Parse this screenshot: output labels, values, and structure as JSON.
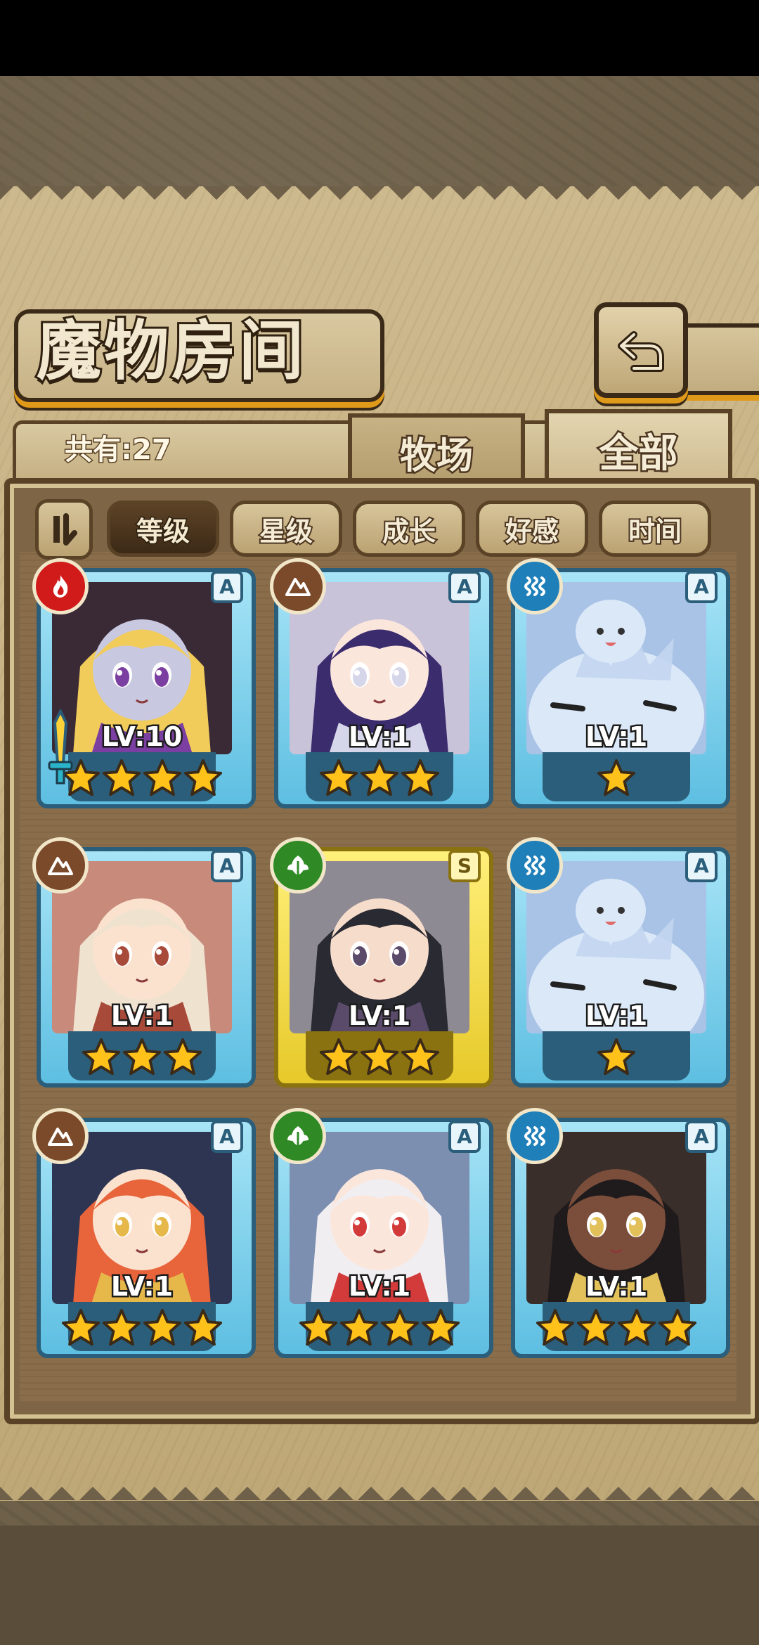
{
  "header": {
    "title": "魔物房间"
  },
  "count": {
    "label": "共有:27"
  },
  "tabs": [
    {
      "label": "牧场",
      "active": false
    },
    {
      "label": "全部",
      "active": true
    }
  ],
  "sort": {
    "buttons": [
      {
        "label": "等级",
        "active": true
      },
      {
        "label": "星级",
        "active": false
      },
      {
        "label": "成长",
        "active": false
      },
      {
        "label": "好感",
        "active": false
      },
      {
        "label": "时间",
        "active": false
      }
    ]
  },
  "colors": {
    "fire": "#d11a1a",
    "earth": "#7a4a2a",
    "water": "#1f7fb8",
    "wood": "#2f8a25",
    "card_frame_a": "#5ebfe2",
    "card_frame_s": "#e7c92a",
    "star": "#ffc21a"
  },
  "monsters": [
    {
      "element": "fire",
      "rank": "A",
      "level": "LV:10",
      "stars": 4,
      "equipped": true,
      "portrait": "blonde-demon-girl"
    },
    {
      "element": "earth",
      "rank": "A",
      "level": "LV:1",
      "stars": 3,
      "equipped": false,
      "portrait": "purple-hair-girl"
    },
    {
      "element": "water",
      "rank": "A",
      "level": "LV:1",
      "stars": 1,
      "equipped": false,
      "portrait": "blue-slime"
    },
    {
      "element": "earth",
      "rank": "A",
      "level": "LV:1",
      "stars": 3,
      "equipped": false,
      "portrait": "cream-hair-girl"
    },
    {
      "element": "wood",
      "rank": "S",
      "level": "LV:1",
      "stars": 3,
      "equipped": false,
      "portrait": "black-hair-glasses-girl"
    },
    {
      "element": "water",
      "rank": "A",
      "level": "LV:1",
      "stars": 1,
      "equipped": false,
      "portrait": "blue-slime"
    },
    {
      "element": "earth",
      "rank": "A",
      "level": "LV:1",
      "stars": 4,
      "equipped": false,
      "portrait": "redhead-hooded-girl"
    },
    {
      "element": "wood",
      "rank": "A",
      "level": "LV:1",
      "stars": 4,
      "equipped": false,
      "portrait": "white-hat-girl"
    },
    {
      "element": "water",
      "rank": "A",
      "level": "LV:1",
      "stars": 4,
      "equipped": false,
      "portrait": "pharaoh-girl"
    }
  ]
}
